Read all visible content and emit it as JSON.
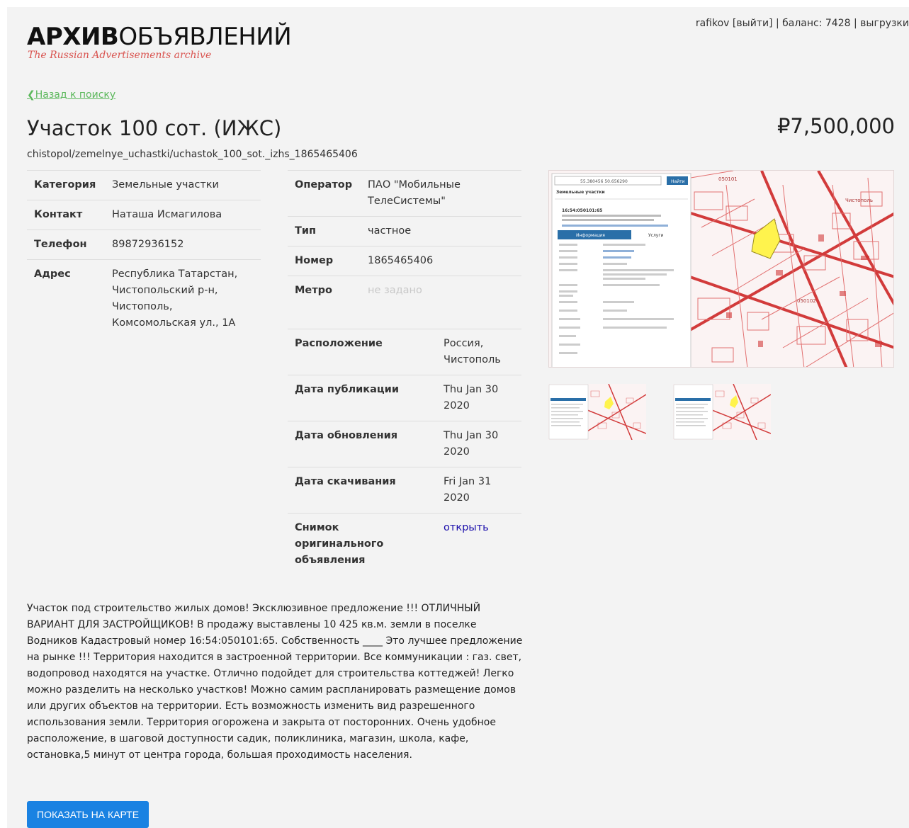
{
  "header": {
    "logo_bold": "АРХИВ",
    "logo_rest": "ОБЪЯВЛЕНИЙ",
    "tagline": "The Russian Advertisements archive",
    "user": "rafikov",
    "logout": "[выйти]",
    "sep1": " | ",
    "balance": "баланс: 7428",
    "sep2": " | ",
    "exports": "выгрузки"
  },
  "back_link": "❮Назад к поиску",
  "ad": {
    "title": "Участок 100 сот. (ИЖС)",
    "price": "₽7,500,000",
    "slug": "chistopol/zemelnye_uchastki/uchastok_100_sot._izhs_1865465406"
  },
  "details_left": [
    {
      "label": "Категория",
      "value": "Земельные участки"
    },
    {
      "label": "Контакт",
      "value": "Наташа Исмагилова"
    },
    {
      "label": "Телефон",
      "value": "89872936152"
    },
    {
      "label": "Адрес",
      "value": "Республика Татарстан, Чистопольский р-н, Чистополь, Комсомольская ул., 1А"
    }
  ],
  "details_mid": [
    {
      "label": "Оператор",
      "value": "ПАО \"Мобильные ТелеСистемы\""
    },
    {
      "label": "Тип",
      "value": "частное"
    },
    {
      "label": "Номер",
      "value": "1865465406"
    },
    {
      "label": "Метро",
      "value": "не задано"
    }
  ],
  "details_lower": [
    {
      "label": "Расположение",
      "value": "Россия, Чистополь"
    },
    {
      "label": "Дата публикации",
      "value": "Thu Jan 30 2020"
    },
    {
      "label": "Дата обновления",
      "value": "Thu Jan 30 2020"
    },
    {
      "label": "Дата скачивания",
      "value": "Fri Jan 31 2020"
    },
    {
      "label": "Снимок оригинального объявления",
      "value": "открыть"
    }
  ],
  "description": "Участок под строительство жилых домов! Эксклюзивное предложение !!! ОТЛИЧНЫЙ ВАРИАНТ ДЛЯ ЗАСТРОЙЩИКОВ! В продажу выставлены 10 425 кв.м. земли в поселке Водников Кадастровый номер 16:54:050101:65. Собственность ____ Это лучшее предложение на рынке !!! Территория находится в застроенной территории. Все коммуникации : газ. свет, водопровод находятся на участке. Отлично подойдет для строительства коттеджей! Легко можно разделить на несколько участков! Можно самим распланировать размещение домов или других объектов на территории. Есть возможность изменить вид разрешенного использования земли. Территория огорожена и закрыта от посторонних. Очень удобное расположение, в шаговой доступности садик, поликлиника, магазин, школа, кафе, остановка,5 минут от центра города, большая проходимость населения.",
  "map_button": "ПОКАЗАТЬ НА КАРТЕ",
  "photo": {
    "search_value": "55.380456 50.656290",
    "search_btn": "Найти",
    "panel_header": "Земельные участки",
    "cad_id": "16:54:050101:65",
    "tab_info": "Информация",
    "tab_services": "Услуги",
    "map_label_1": "050101",
    "map_label_2": "Чистополь",
    "map_label_3": "050102"
  },
  "thumbs_count": 2
}
